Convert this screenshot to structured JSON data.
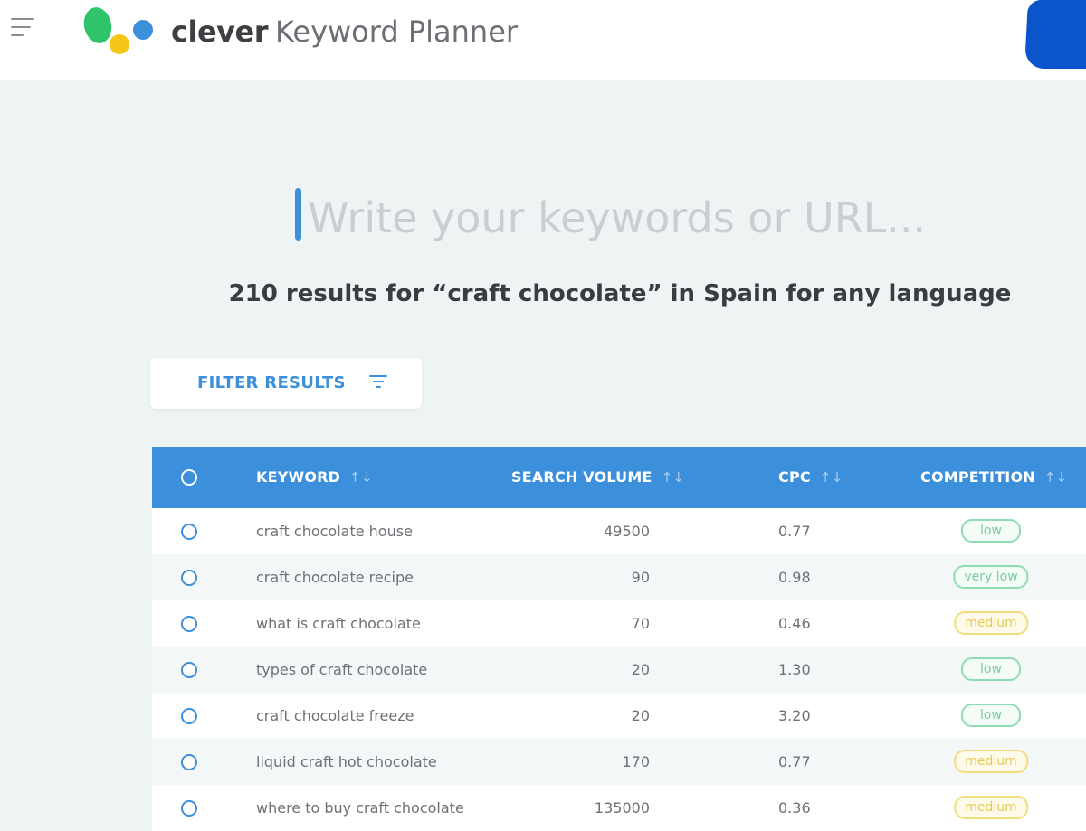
{
  "header": {
    "brand_name": "clever",
    "product_name": "Keyword Planner",
    "logo_colors": [
      "#2fc46a",
      "#f5c518",
      "#3b8fdb"
    ]
  },
  "search": {
    "placeholder": "Write your keywords or URL..."
  },
  "results_summary": "210 results for “craft chocolate” in Spain for any language",
  "filter": {
    "label": "FILTER RESULTS"
  },
  "table": {
    "columns": [
      "KEYWORD",
      "SEARCH VOLUME",
      "CPC",
      "COMPETITION"
    ],
    "sort_glyph": "↑↓",
    "rows": [
      {
        "keyword": "craft chocolate house",
        "search_volume": "49500",
        "cpc": "0.77",
        "competition": "low"
      },
      {
        "keyword": "craft chocolate recipe",
        "search_volume": "90",
        "cpc": "0.98",
        "competition": "very low"
      },
      {
        "keyword": "what is craft chocolate",
        "search_volume": "70",
        "cpc": "0.46",
        "competition": "medium"
      },
      {
        "keyword": "types of craft chocolate",
        "search_volume": "20",
        "cpc": "1.30",
        "competition": "low"
      },
      {
        "keyword": "craft chocolate freeze",
        "search_volume": "20",
        "cpc": "3.20",
        "competition": "low"
      },
      {
        "keyword": "liquid craft hot chocolate",
        "search_volume": "170",
        "cpc": "0.77",
        "competition": "medium"
      },
      {
        "keyword": "where to buy craft chocolate",
        "search_volume": "135000",
        "cpc": "0.36",
        "competition": "medium"
      }
    ]
  },
  "colors": {
    "accent": "#3b8fdb",
    "page_background": "#eef3f3",
    "low": "#8fdcb4",
    "medium": "#f3dc7b"
  }
}
